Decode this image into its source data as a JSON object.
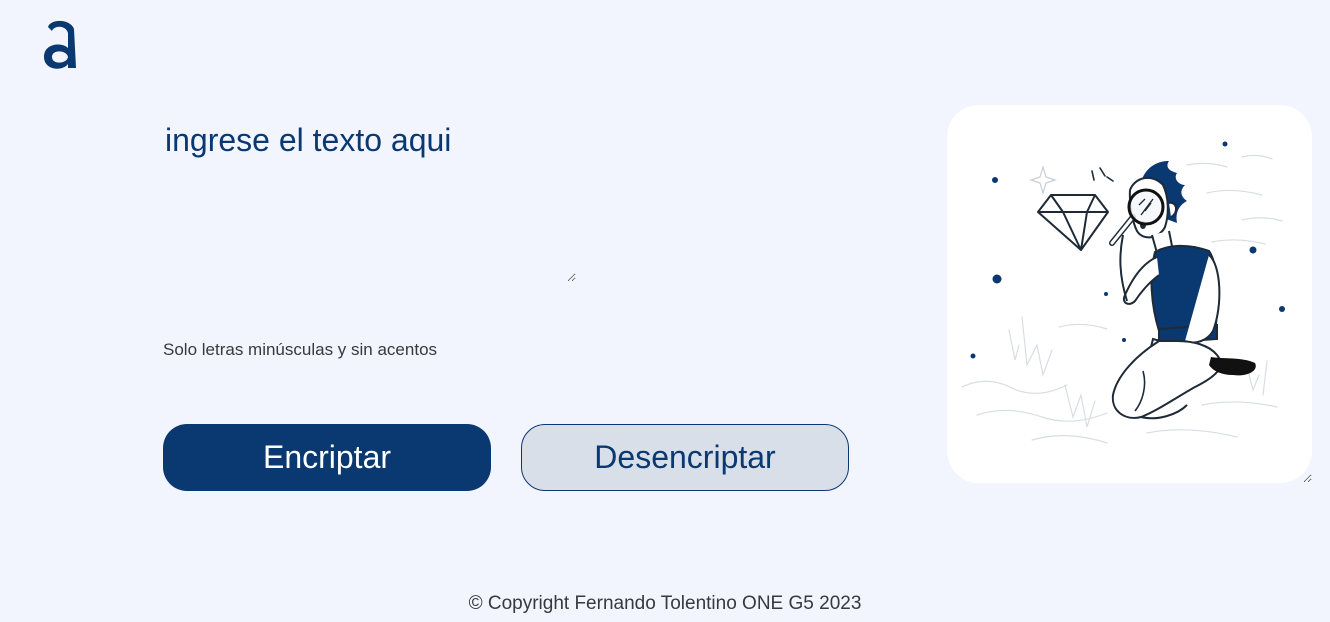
{
  "logo": {
    "icon": "alura-a-logo-icon",
    "color": "#0a3871"
  },
  "input": {
    "placeholder": "ingrese el texto aqui",
    "value": ""
  },
  "hint": {
    "text": "Solo letras minúsculas y sin acentos"
  },
  "buttons": {
    "encrypt_label": "Encriptar",
    "decrypt_label": "Desencriptar"
  },
  "output": {
    "illustration": "person-with-magnifying-glass-illustration"
  },
  "footer": {
    "text": "© Copyright Fernando Tolentino ONE G5 2023"
  },
  "colors": {
    "primary": "#0a3871",
    "background": "#f2f5fd",
    "secondary_button": "#d8dfe8",
    "panel": "#ffffff"
  }
}
